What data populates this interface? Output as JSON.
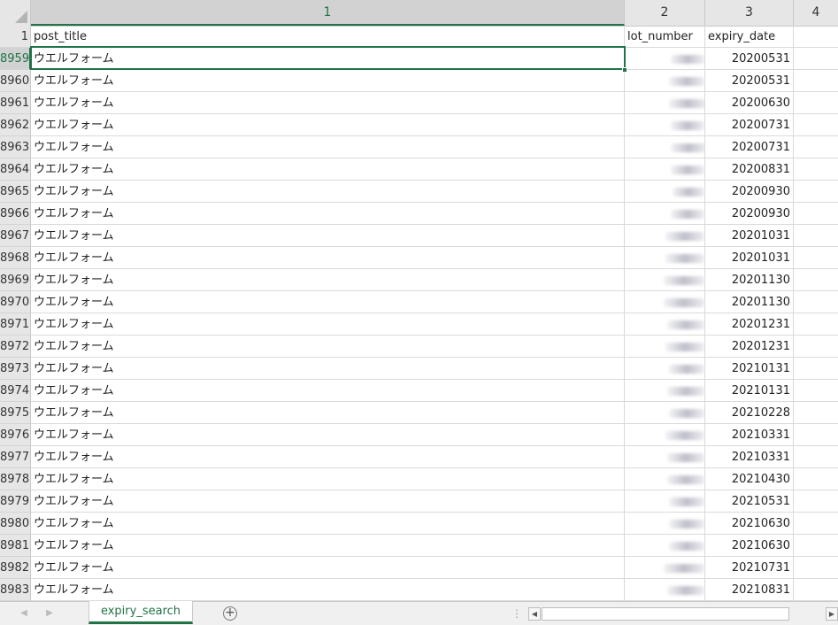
{
  "columns": {
    "c1": "1",
    "c2": "2",
    "c3": "3",
    "c4": "4"
  },
  "header_row": {
    "num": "1",
    "post_title": "post_title",
    "lot_number": "lot_number",
    "expiry_date": "expiry_date"
  },
  "rows": [
    {
      "num": "8959",
      "title": "ウエルフォーム",
      "expiry": "20200531"
    },
    {
      "num": "8960",
      "title": "ウエルフォーム",
      "expiry": "20200531"
    },
    {
      "num": "8961",
      "title": "ウエルフォーム",
      "expiry": "20200630"
    },
    {
      "num": "8962",
      "title": "ウエルフォーム",
      "expiry": "20200731"
    },
    {
      "num": "8963",
      "title": "ウエルフォーム",
      "expiry": "20200731"
    },
    {
      "num": "8964",
      "title": "ウエルフォーム",
      "expiry": "20200831"
    },
    {
      "num": "8965",
      "title": "ウエルフォーム",
      "expiry": "20200930"
    },
    {
      "num": "8966",
      "title": "ウエルフォーム",
      "expiry": "20200930"
    },
    {
      "num": "8967",
      "title": "ウエルフォーム",
      "expiry": "20201031"
    },
    {
      "num": "8968",
      "title": "ウエルフォーム",
      "expiry": "20201031"
    },
    {
      "num": "8969",
      "title": "ウエルフォーム",
      "expiry": "20201130"
    },
    {
      "num": "8970",
      "title": "ウエルフォーム",
      "expiry": "20201130"
    },
    {
      "num": "8971",
      "title": "ウエルフォーム",
      "expiry": "20201231"
    },
    {
      "num": "8972",
      "title": "ウエルフォーム",
      "expiry": "20201231"
    },
    {
      "num": "8973",
      "title": "ウエルフォーム",
      "expiry": "20210131"
    },
    {
      "num": "8974",
      "title": "ウエルフォーム",
      "expiry": "20210131"
    },
    {
      "num": "8975",
      "title": "ウエルフォーム",
      "expiry": "20210228"
    },
    {
      "num": "8976",
      "title": "ウエルフォーム",
      "expiry": "20210331"
    },
    {
      "num": "8977",
      "title": "ウエルフォーム",
      "expiry": "20210331"
    },
    {
      "num": "8978",
      "title": "ウエルフォーム",
      "expiry": "20210430"
    },
    {
      "num": "8979",
      "title": "ウエルフォーム",
      "expiry": "20210531"
    },
    {
      "num": "8980",
      "title": "ウエルフォーム",
      "expiry": "20210630"
    },
    {
      "num": "8981",
      "title": "ウエルフォーム",
      "expiry": "20210630"
    },
    {
      "num": "8982",
      "title": "ウエルフォーム",
      "expiry": "20210731"
    },
    {
      "num": "8983",
      "title": "ウエルフォーム",
      "expiry": "20210831"
    }
  ],
  "sheet_tabs": [
    {
      "label": "expiry_search",
      "active": true
    }
  ],
  "icons": {
    "add_sheet": "plus-circle-icon",
    "prev_sheet": "triangle-left-icon",
    "next_sheet": "triangle-right-icon"
  },
  "colors": {
    "accent": "#217346"
  }
}
